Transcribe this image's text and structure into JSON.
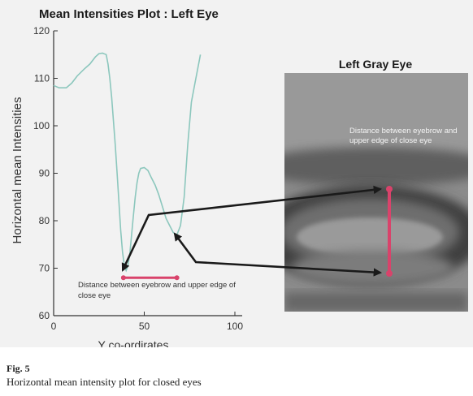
{
  "figure": {
    "label": "Fig. 5",
    "caption": "Horizontal mean intensity plot for closed eyes"
  },
  "colors": {
    "curve": "#8cc7bd",
    "marker": "#d9436b",
    "arrow": "#1a1a1a",
    "panel_bg": "#f2f2f2"
  },
  "chart_data": {
    "type": "line",
    "title": "Mean Intensities Plot : Left Eye",
    "xlabel": "Y co-ordirates",
    "ylabel": "Horizontal mean Intensities",
    "xlim": [
      0,
      100
    ],
    "ylim": [
      60,
      120
    ],
    "xticks": [
      "0",
      "50",
      "100"
    ],
    "yticks": [
      "60",
      "70",
      "80",
      "90",
      "100",
      "110",
      "120"
    ],
    "grid": false,
    "series": [
      {
        "x": [
          0,
          3,
          7,
          10,
          13,
          17,
          20,
          23,
          25,
          27,
          29,
          30,
          31,
          32,
          33,
          34,
          35,
          36,
          37,
          38,
          39,
          40,
          41,
          42,
          43,
          44,
          45,
          46,
          47,
          48,
          50,
          52,
          54,
          56,
          58,
          60,
          62,
          64,
          66,
          68,
          70,
          72,
          74,
          76,
          78,
          80,
          81
        ],
        "y": [
          108.5,
          108,
          108,
          109,
          110.5,
          112,
          113,
          114.5,
          115.2,
          115.3,
          115,
          113,
          110,
          106,
          101,
          96,
          90,
          84,
          78,
          73.5,
          70.5,
          69.5,
          70.5,
          73,
          77,
          81,
          85,
          88,
          90,
          91,
          91.2,
          90.6,
          89,
          87.5,
          85.5,
          83,
          80.5,
          79,
          77.5,
          77,
          79,
          85,
          96,
          105,
          109,
          113,
          115
        ]
      }
    ],
    "annotations": {
      "plot_measure_label": "Distance between eyebrow and upper edge of close eye",
      "plot_measure_from": 38.5,
      "plot_measure_to": 68,
      "plot_measure_y": 68,
      "image_title": "Left Gray Eye",
      "image_measure_label": "Distance between eyebrow and upper edge of close eye"
    }
  }
}
